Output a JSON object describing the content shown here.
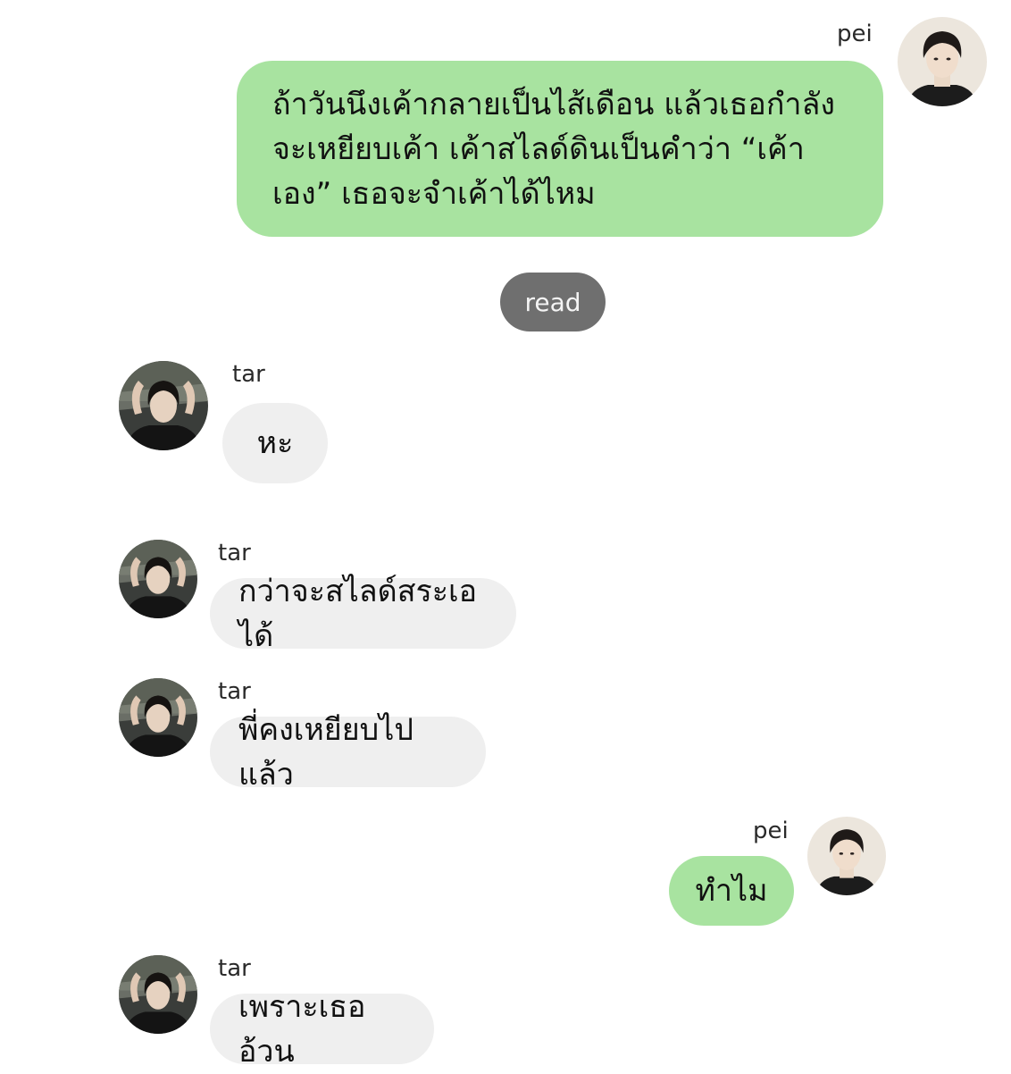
{
  "messages": [
    {
      "sender": "pei",
      "direction": "outgoing",
      "text": "ถ้าวันนึงเค้ากลายเป็นไส้เดือน แล้วเธอกำลังจะเหยียบเค้า เค้าสไลด์ดินเป็นคำว่า “เค้าเอง” เธอจะจำเค้าได้ไหม"
    },
    {
      "sender": "tar",
      "direction": "incoming",
      "text": "หะ"
    },
    {
      "sender": "tar",
      "direction": "incoming",
      "text": "กว่าจะสไลด์สระเอได้"
    },
    {
      "sender": "tar",
      "direction": "incoming",
      "text": "พี่คงเหยียบไปแล้ว"
    },
    {
      "sender": "pei",
      "direction": "outgoing",
      "text": "ทำไม"
    },
    {
      "sender": "tar",
      "direction": "incoming",
      "text": "เพราะเธออ้วน"
    }
  ],
  "status": {
    "read_label": "read"
  },
  "colors": {
    "outgoing_bubble": "#a8e3a0",
    "incoming_bubble": "#efefef",
    "read_pill": "#6f6f6f"
  },
  "icons": {
    "pei_avatar": "avatar-photo",
    "tar_avatar": "avatar-photo"
  }
}
